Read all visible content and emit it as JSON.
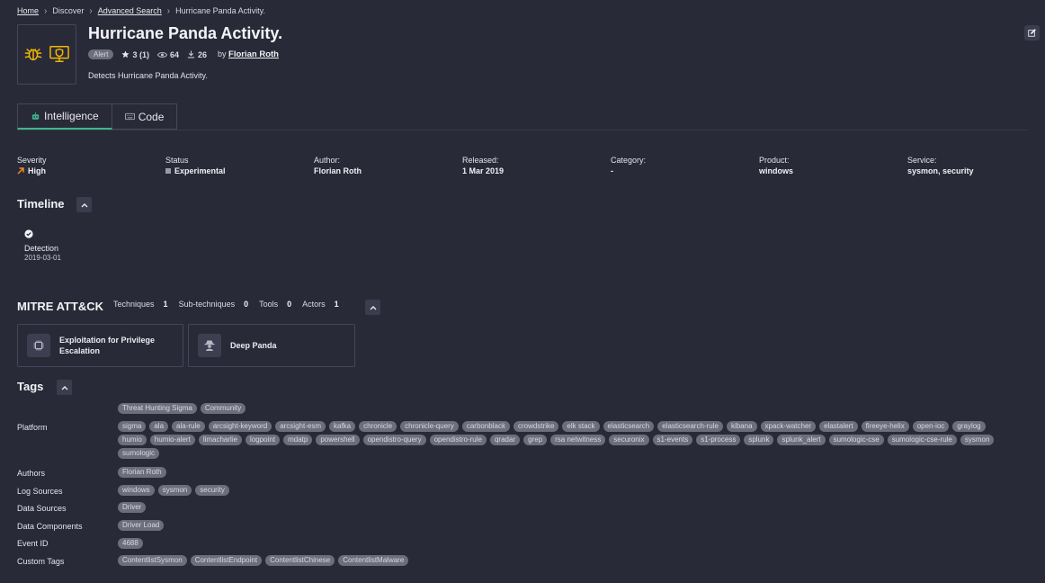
{
  "breadcrumb": [
    {
      "label": "Home",
      "link": true
    },
    {
      "label": "Discover",
      "link": false
    },
    {
      "label": "Advanced Search",
      "link": true
    },
    {
      "label": "Hurricane Panda Activity.",
      "link": false
    }
  ],
  "header": {
    "title": "Hurricane Panda Activity.",
    "badge": "Alert",
    "stars": "3 (1)",
    "views": "64",
    "downloads": "26",
    "by_prefix": "by",
    "author": "Florian Roth",
    "description": "Detects Hurricane Panda Activity."
  },
  "tabs": [
    {
      "label": "Intelligence",
      "icon": "robot-icon",
      "active": true
    },
    {
      "label": "Code",
      "icon": "keyboard-icon",
      "active": false
    }
  ],
  "info": {
    "severity_label": "Severity",
    "severity_value": "High",
    "status_label": "Status",
    "status_value": "Experimental",
    "author_label": "Author:",
    "author_value": "Florian Roth",
    "released_label": "Released:",
    "released_value": "1 Mar 2019",
    "category_label": "Category:",
    "category_value": "-",
    "product_label": "Product:",
    "product_value": "windows",
    "service_label": "Service:",
    "service_value": "sysmon, security"
  },
  "timeline": {
    "title": "Timeline",
    "items": [
      {
        "label": "Detection",
        "date": "2019-03-01"
      }
    ]
  },
  "mitre": {
    "title": "MITRE ATT&CK",
    "techniques_label": "Techniques",
    "techniques": "1",
    "subtechniques_label": "Sub-techniques",
    "subtechniques": "0",
    "tools_label": "Tools",
    "tools": "0",
    "actors_label": "Actors",
    "actors": "1",
    "cards": [
      {
        "label": "Exploitation for Privilege Escalation",
        "icon": "chip-icon"
      },
      {
        "label": "Deep Panda",
        "icon": "spy-icon"
      }
    ]
  },
  "tags": {
    "title": "Tags",
    "top_chips": [
      "Threat Hunting Sigma",
      "Community"
    ],
    "platform_label": "Platform",
    "platform": [
      "sigma",
      "ala",
      "ala-rule",
      "arcsight-keyword",
      "arcsight-esm",
      "kafka",
      "chronicle",
      "chronicle-query",
      "carbonblack",
      "crowdstrike",
      "elk stack",
      "elasticsearch",
      "elasticsearch-rule",
      "kibana",
      "xpack-watcher",
      "elastalert",
      "fireeye-helix",
      "open-ioc",
      "graylog",
      "humio",
      "humio-alert",
      "limacharlie",
      "logpoint",
      "mdatp",
      "powershell",
      "opendistro-query",
      "opendistro-rule",
      "qradar",
      "grep",
      "rsa netwitness",
      "securonix",
      "s1-events",
      "s1-process",
      "splunk",
      "splunk_alert",
      "sumologic-cse",
      "sumologic-cse-rule",
      "sysmon",
      "sumologic"
    ],
    "authors_label": "Authors",
    "authors": [
      "Florian Roth"
    ],
    "log_sources_label": "Log Sources",
    "log_sources": [
      "windows",
      "sysmon",
      "security"
    ],
    "data_sources_label": "Data Sources",
    "data_sources": [
      "Driver"
    ],
    "data_components_label": "Data Components",
    "data_components": [
      "Driver Load"
    ],
    "event_id_label": "Event ID",
    "event_id": [
      "4688"
    ],
    "custom_tags_label": "Custom Tags",
    "custom_tags": [
      "ContentlistSysmon",
      "ContentlistEndpoint",
      "ContentlistChinese",
      "ContentlistMalware"
    ]
  },
  "colors": {
    "accent": "#3fb58f",
    "severity_high": "#f08a24",
    "icon_yellow": "#f2b705",
    "bg": "#292a38"
  }
}
